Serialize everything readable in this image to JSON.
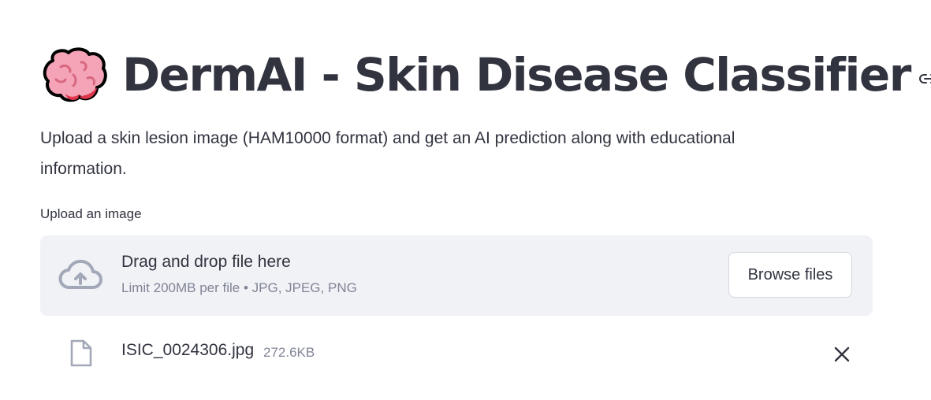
{
  "header": {
    "emoji_icon": "brain-emoji-icon",
    "title": "DermAI - Skin Disease Classifier",
    "anchor_icon": "link-icon"
  },
  "description": "Upload a skin lesion image (HAM10000 format) and get an AI prediction along with educational information.",
  "uploader": {
    "label": "Upload an image",
    "dropzone_icon": "cloud-upload-icon",
    "dropzone_text": "Drag and drop file here",
    "limit_text": "Limit 200MB per file • JPG, JPEG, PNG",
    "browse_label": "Browse files"
  },
  "uploaded_file": {
    "icon": "file-icon",
    "name": "ISIC_0024306.jpg",
    "size": "272.6KB",
    "remove_icon": "close-icon"
  },
  "colors": {
    "text": "#31333f",
    "muted": "#808495",
    "dropzone_bg": "#f0f2f6",
    "icon": "#a3a8b8",
    "brain_pink": "#f4a4b6",
    "brain_red": "#e0374f"
  }
}
